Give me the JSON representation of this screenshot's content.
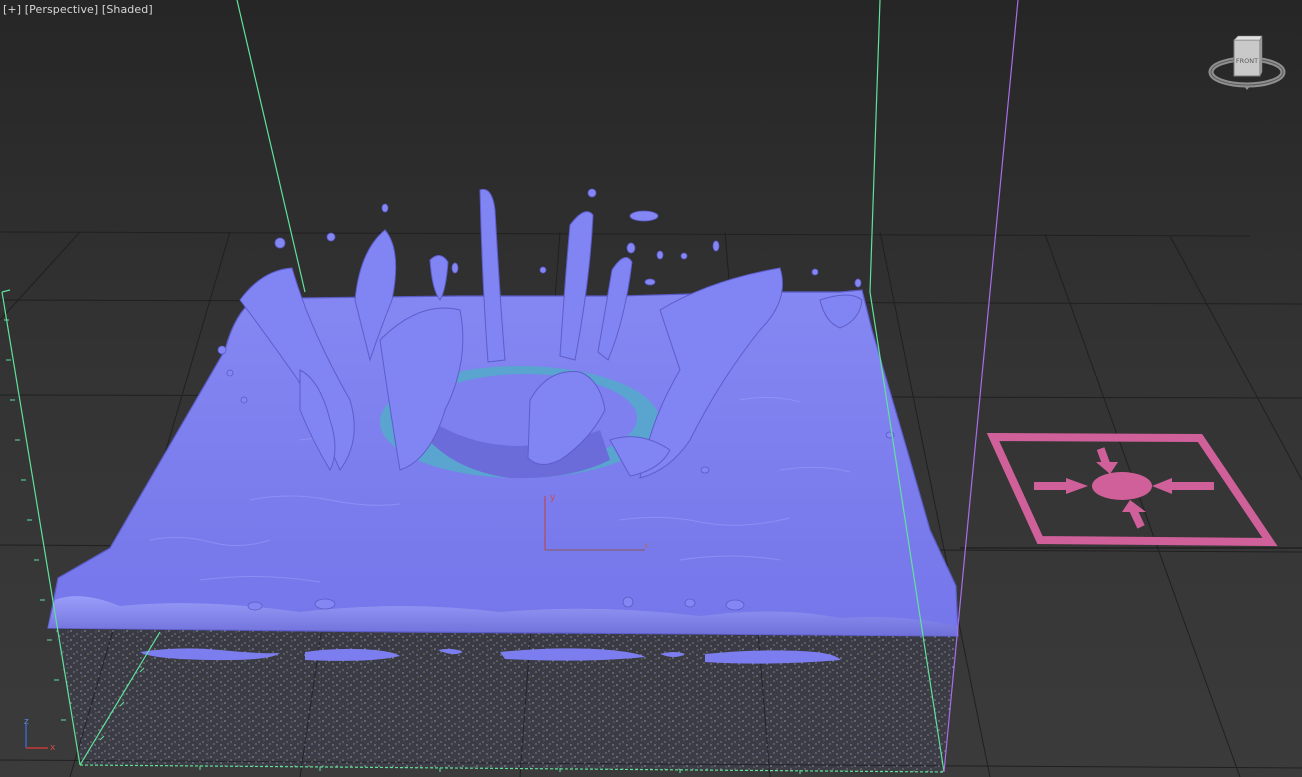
{
  "viewport": {
    "label_plus": "[+]",
    "label_view": "[Perspective]",
    "label_shading": "[Shaded]"
  },
  "viewcube": {
    "face_label": "FRONT"
  },
  "gizmo": {
    "x_label": "x",
    "y_label": "y"
  },
  "axis_tripod": {
    "z_label": "z",
    "x_label": "x"
  },
  "icons": {
    "force_icon": "gravity-force-icon"
  },
  "colors": {
    "fluid": "#7c7df0",
    "fluid_shadow": "#5a58c4",
    "fluid_highlight": "#a3a6ff",
    "crater_ring": "#5aa4d0",
    "force_icon": "#d0609a",
    "bbox_green": "#5fe29a",
    "bbox_purple": "#a86de8",
    "grid": "#1c1c1c",
    "particles": "#ffffff"
  }
}
